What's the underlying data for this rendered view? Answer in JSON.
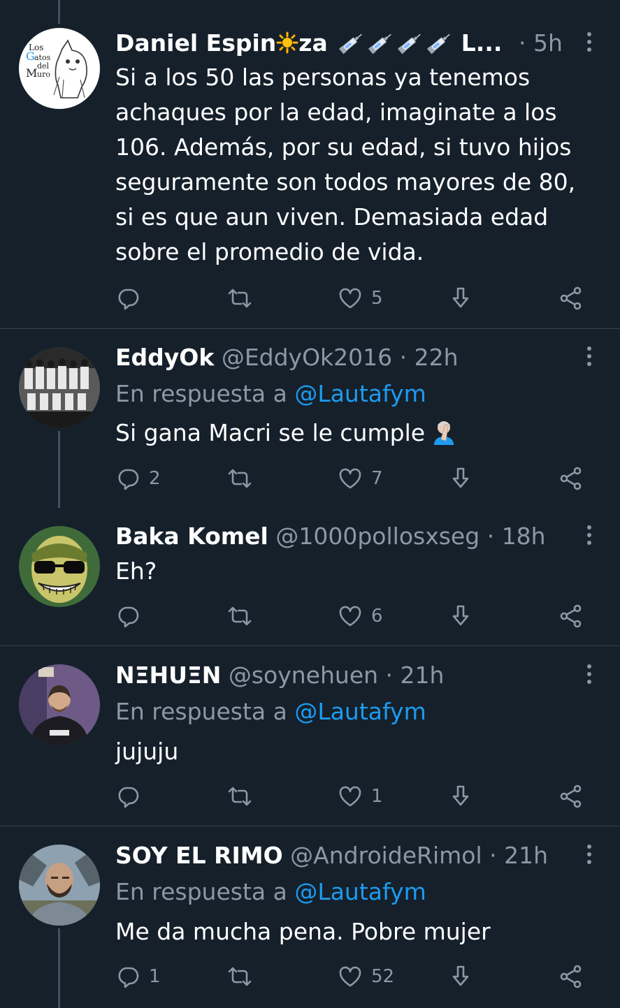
{
  "colors": {
    "background": "#15202b",
    "text": "#ffffff",
    "muted": "#8b98a5",
    "link": "#1d9bf0",
    "divider": "#38444d"
  },
  "tweets": [
    {
      "name_part1": "Daniel Espin",
      "name_part2": "za",
      "name_suffix": "L...",
      "dot": "·",
      "time": "5h",
      "avatar": "los-gatos-del-muro-logo",
      "avatar_text": "Los Gatos del Muro",
      "body": "Si a los 50 las personas ya tenemos achaques por la edad, imaginate a los 106. Además, por su edad, si tuvo hijos seguramente son todos mayores de 80, si es que aun viven. Demasiada edad sobre el promedio de vida.",
      "replies": "",
      "retweets": "",
      "likes": "5"
    },
    {
      "name": "EddyOk",
      "handle": "@EddyOk2016",
      "dot": "·",
      "time": "22h",
      "avatar": "team-photo-avatar",
      "replying_prefix": "En respuesta a ",
      "replying_to": "@Lautafym",
      "body": "Si gana Macri se le cumple",
      "replies": "2",
      "retweets": "",
      "likes": "7"
    },
    {
      "name": "Baka Komel",
      "handle": "@1000pollosxseg",
      "dot": "·",
      "time": "18h",
      "avatar": "cartoon-face-avatar",
      "body": "Eh?",
      "replies": "",
      "retweets": "",
      "likes": "6"
    },
    {
      "name": "NΞHUΞN",
      "handle": "@soynehuen",
      "dot": "·",
      "time": "21h",
      "avatar": "man-photo-avatar",
      "replying_prefix": "En respuesta a ",
      "replying_to": "@Lautafym",
      "body": "jujuju",
      "replies": "",
      "retweets": "",
      "likes": "1"
    },
    {
      "name": "SOY EL RIMO",
      "handle": "@AndroideRimol",
      "dot": "·",
      "time": "21h",
      "avatar": "bald-man-photo-avatar",
      "replying_prefix": "En respuesta a ",
      "replying_to": "@Lautafym",
      "body": "Me da mucha pena. Pobre mujer",
      "replies": "1",
      "retweets": "",
      "likes": "52"
    }
  ],
  "icons": {
    "reply": "reply-icon",
    "retweet": "retweet-icon",
    "like": "heart-icon",
    "share": "share-icon",
    "download": "download-arrow-icon",
    "more": "more-options-icon"
  }
}
